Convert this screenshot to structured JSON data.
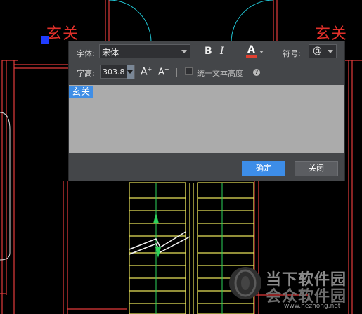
{
  "drawing": {
    "label_left": "玄关",
    "label_right": "玄关"
  },
  "dialog": {
    "font_label": "字体:",
    "font_value": "宋体",
    "bold": "B",
    "italic": "I",
    "color_letter": "A",
    "symbol_label": "符号:",
    "symbol_value": "@",
    "height_label": "字高:",
    "height_value": "303.8",
    "increase_label": "A",
    "decrease_label": "A",
    "uniform_label": "统一文本高度",
    "help": "?",
    "editor_text": "玄关",
    "ok": "确定",
    "close": "关闭"
  },
  "watermark": {
    "line1": "当下软件园",
    "line2": "会众软件园",
    "url": "www.hezhong.net"
  }
}
